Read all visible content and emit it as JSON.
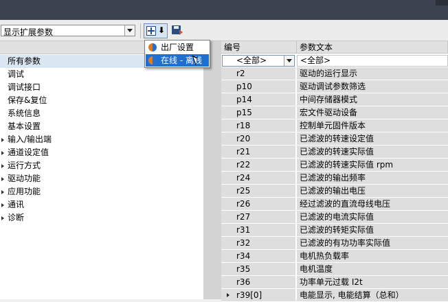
{
  "toolbar": {
    "view_select_value": "显示扩展参数",
    "filter_icon": "factory-online-filter-icon",
    "download_icon": "download-arrow-icon",
    "save_icon": "save-disk-icon"
  },
  "filter_menu": {
    "items": [
      {
        "label": "出厂设置",
        "icon": "half-circle-icon",
        "highlighted": false
      },
      {
        "label": "在线 - 离线",
        "icon": "half-circle-icon",
        "highlighted": true
      }
    ]
  },
  "tree": {
    "items": [
      {
        "label": "所有参数",
        "expandable": false,
        "selected": true
      },
      {
        "label": "调试",
        "expandable": false
      },
      {
        "label": "调试接口",
        "expandable": false
      },
      {
        "label": "保存&复位",
        "expandable": false
      },
      {
        "label": "系统信息",
        "expandable": false
      },
      {
        "label": "基本设置",
        "expandable": false
      },
      {
        "label": "输入/输出端",
        "expandable": true
      },
      {
        "label": "通道设定值",
        "expandable": true
      },
      {
        "label": "运行方式",
        "expandable": true
      },
      {
        "label": "驱动功能",
        "expandable": true
      },
      {
        "label": "应用功能",
        "expandable": true
      },
      {
        "label": "通讯",
        "expandable": true
      },
      {
        "label": "诊断",
        "expandable": true
      }
    ]
  },
  "grid": {
    "col_number": "编号",
    "col_text": "参数文本",
    "filter_number": "<全部>",
    "filter_text": "<全部>",
    "rows": [
      {
        "number": "r2",
        "text": "驱动的运行显示"
      },
      {
        "number": "p10",
        "text": "驱动调试参数筛选"
      },
      {
        "number": "p14",
        "text": "中间存储器模式"
      },
      {
        "number": "p15",
        "text": "宏文件驱动设备"
      },
      {
        "number": "r18",
        "text": "控制单元固件版本"
      },
      {
        "number": "r20",
        "text": "已滤波的转速设定值"
      },
      {
        "number": "r21",
        "text": "已滤波的转速实际值"
      },
      {
        "number": "r22",
        "text": "已滤波的转速实际值 rpm"
      },
      {
        "number": "r24",
        "text": "已滤波的输出频率"
      },
      {
        "number": "r25",
        "text": "已滤波的输出电压"
      },
      {
        "number": "r26",
        "text": "经过滤波的直流母线电压"
      },
      {
        "number": "r27",
        "text": "已滤波的电流实际值"
      },
      {
        "number": "r31",
        "text": "已滤波的转矩实际值"
      },
      {
        "number": "r32",
        "text": "已滤波的有功功率实际值"
      },
      {
        "number": "r34",
        "text": "电机热负载率"
      },
      {
        "number": "r35",
        "text": "电机温度"
      },
      {
        "number": "r36",
        "text": "功率单元过载 I2t"
      },
      {
        "number": "r39[0]",
        "text": "电能显示, 电能结算（总和）",
        "expandable": true
      }
    ]
  }
}
